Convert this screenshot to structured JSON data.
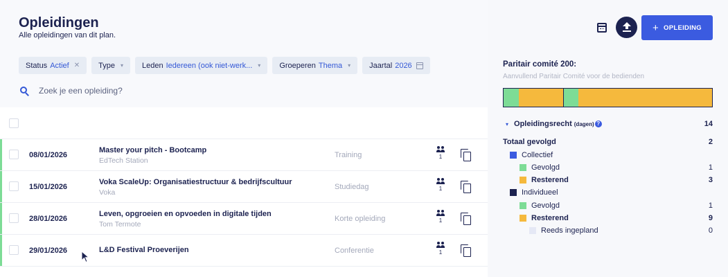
{
  "header": {
    "title": "Opleidingen",
    "subtitle": "Alle opleidingen van dit plan."
  },
  "filters": [
    {
      "label": "Status",
      "value": "Actief",
      "control": "x"
    },
    {
      "label": "Type",
      "value": "",
      "control": "chevron"
    },
    {
      "label": "Leden",
      "value": "Iedereen (ook niet-werk...",
      "control": "chevron"
    },
    {
      "label": "Groeperen",
      "value": "Thema",
      "control": "chevron"
    },
    {
      "label": "Jaartal",
      "value": "2026",
      "control": "calendar"
    }
  ],
  "search": {
    "placeholder": "Zoek je een opleiding?"
  },
  "rows": [
    {
      "date": "08/01/2026",
      "name": "Master your pitch - Bootcamp",
      "organizer": "EdTech Station",
      "type": "Training",
      "participants": "1"
    },
    {
      "date": "15/01/2026",
      "name": "Voka ScaleUp: Organisatiestructuur & bedrijfscultuur",
      "organizer": "Voka",
      "type": "Studiedag",
      "participants": "1"
    },
    {
      "date": "28/01/2026",
      "name": "Leven, opgroeien en opvoeden in digitale tijden",
      "organizer": "Tom Termote",
      "type": "Korte opleiding",
      "participants": "1"
    },
    {
      "date": "29/01/2026",
      "name": "L&D Festival Proeverijen",
      "organizer": "",
      "type": "Conferentie",
      "participants": "1"
    }
  ],
  "toolbar": {
    "add_label": "OPLEIDING"
  },
  "sidebar": {
    "title": "Paritair comité 200:",
    "subtitle": "Aanvullend Paritair Comité voor de bedienden",
    "right_label": "Opleidingsrecht",
    "right_unit": "(dagen)",
    "right_value": 14,
    "total_label": "Totaal gevolgd",
    "total_value": 2,
    "collectief_label": "Collectief",
    "individueel_label": "Individueel",
    "collectief": {
      "gevolgd": 1,
      "resterend": 3
    },
    "individueel": {
      "gevolgd": 1,
      "resterend": 9,
      "ingepland": 0
    },
    "gevolgd_label": "Gevolgd",
    "resterend_label": "Resterend",
    "ingepland_label": "Reeds ingepland"
  },
  "colors": {
    "accent": "#3b5be0",
    "navy": "#1c2250",
    "gevolgd": "#7ddc96",
    "resterend": "#f5b93d",
    "ingepland": "#e5e8f5",
    "row_accent": "#7ddc96"
  }
}
